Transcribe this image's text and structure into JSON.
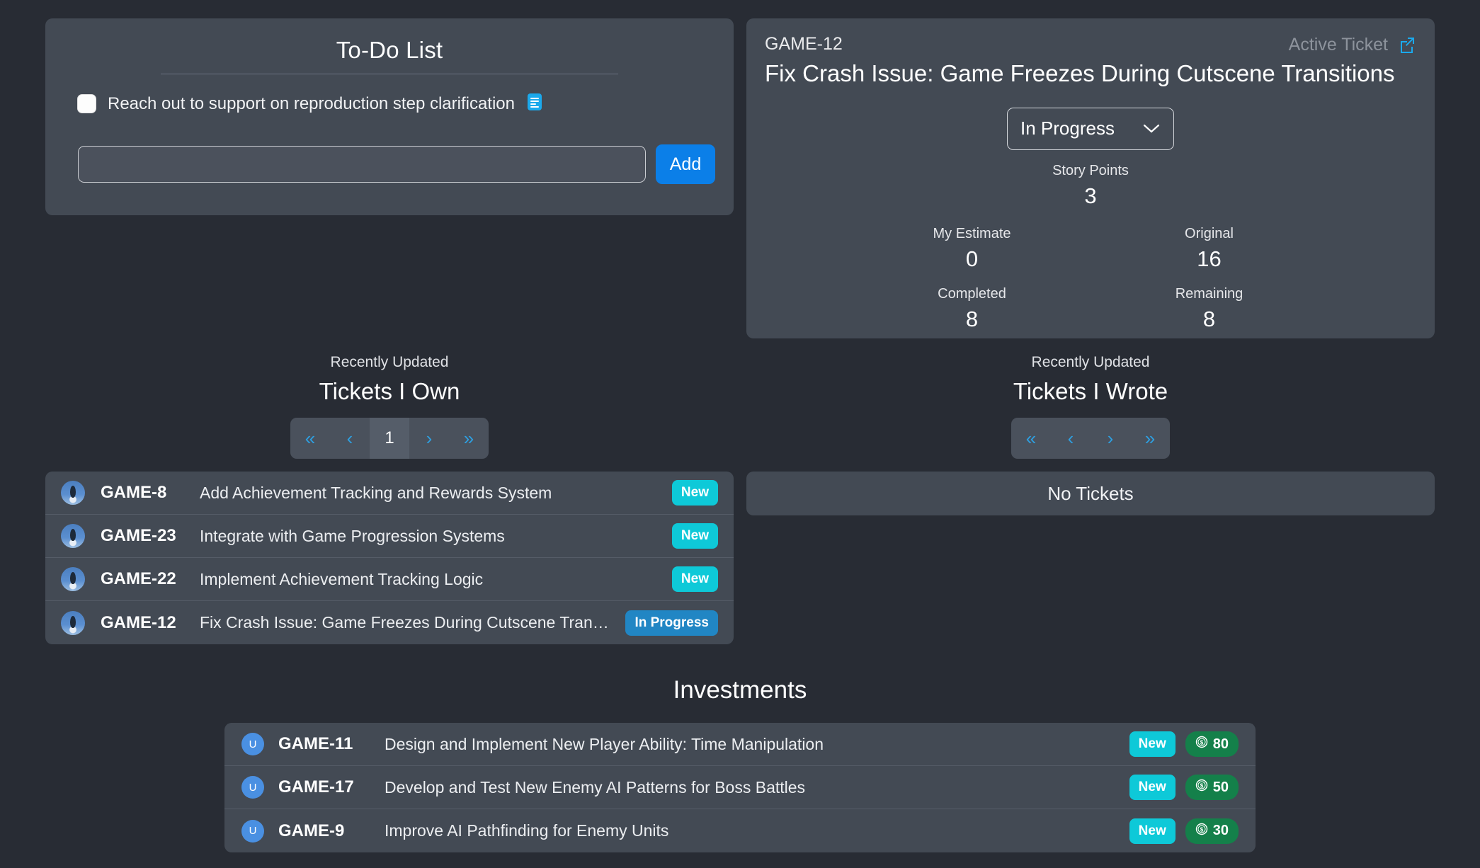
{
  "colors": {
    "page_bg": "#282c34",
    "panel_bg": "#434a54",
    "accent_blue": "#0b7fe8",
    "badge_new": "#0ec9d8",
    "badge_in_progress": "#2186c4",
    "money_green": "#14804a",
    "link_cyan": "#1ba9ec",
    "pager_arrow": "#2e9fe0"
  },
  "todo": {
    "title": "To-Do List",
    "items": [
      {
        "label": "Reach out to support on reproduction step clarification",
        "checked": false,
        "note_icon": "note-icon"
      }
    ],
    "input_value": "",
    "input_placeholder": "",
    "add_label": "Add"
  },
  "active_ticket": {
    "key": "GAME-12",
    "panel_label": "Active Ticket",
    "title": "Fix Crash Issue: Game Freezes During Cutscene Transitions",
    "open_icon": "external-link-icon",
    "status": "In Progress",
    "status_caret_icon": "chevron-down-icon",
    "story_points_label": "Story Points",
    "story_points_value": "3",
    "stats": [
      {
        "label": "My Estimate",
        "value": "0"
      },
      {
        "label": "Original",
        "value": "16"
      },
      {
        "label": "Completed",
        "value": "8"
      },
      {
        "label": "Remaining",
        "value": "8"
      }
    ]
  },
  "tickets_i_own": {
    "subtitle": "Recently Updated",
    "title": "Tickets I Own",
    "pager": {
      "first_icon": "chevron-double-left-icon",
      "prev_icon": "chevron-left-icon",
      "page": "1",
      "next_icon": "chevron-right-icon",
      "last_icon": "chevron-double-right-icon"
    },
    "rows": [
      {
        "avatar": "penguin-avatar",
        "key": "GAME-8",
        "title": "Add Achievement Tracking and Rewards System",
        "status": "New",
        "status_kind": "new"
      },
      {
        "avatar": "penguin-avatar",
        "key": "GAME-23",
        "title": "Integrate with Game Progression Systems",
        "status": "New",
        "status_kind": "new"
      },
      {
        "avatar": "penguin-avatar",
        "key": "GAME-22",
        "title": "Implement Achievement Tracking Logic",
        "status": "New",
        "status_kind": "new"
      },
      {
        "avatar": "penguin-avatar",
        "key": "GAME-12",
        "title": "Fix Crash Issue: Game Freezes During Cutscene Transit...",
        "status": "In Progress",
        "status_kind": "prog"
      }
    ]
  },
  "tickets_i_wrote": {
    "subtitle": "Recently Updated",
    "title": "Tickets I Wrote",
    "pager": {
      "first_icon": "chevron-double-left-icon",
      "prev_icon": "chevron-left-icon",
      "next_icon": "chevron-right-icon",
      "last_icon": "chevron-double-right-icon"
    },
    "empty_text": "No Tickets"
  },
  "investments": {
    "title": "Investments",
    "rows": [
      {
        "avatar_initial": "U",
        "key": "GAME-11",
        "title": "Design and Implement New Player Ability: Time Manipulation",
        "status": "New",
        "amount": "80",
        "money_icon": "dollar-coin-icon"
      },
      {
        "avatar_initial": "U",
        "key": "GAME-17",
        "title": "Develop and Test New Enemy AI Patterns for Boss Battles",
        "status": "New",
        "amount": "50",
        "money_icon": "dollar-coin-icon"
      },
      {
        "avatar_initial": "U",
        "key": "GAME-9",
        "title": "Improve AI Pathfinding for Enemy Units",
        "status": "New",
        "amount": "30",
        "money_icon": "dollar-coin-icon"
      }
    ]
  }
}
